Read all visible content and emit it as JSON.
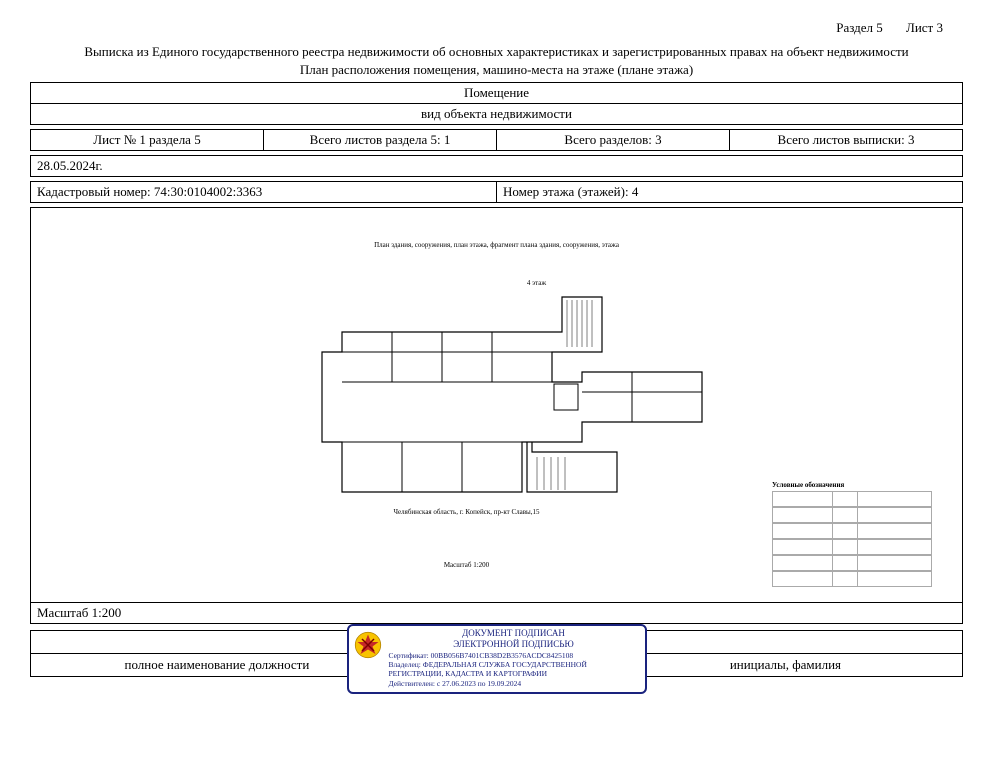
{
  "header": {
    "section": "Раздел 5",
    "sheet": "Лист 3",
    "title1": "Выписка из Единого государственного реестра недвижимости об основных характеристиках и зарегистрированных правах на объект недвижимости",
    "title2": "План расположения помещения, машино-места на этаже (плане этажа)"
  },
  "object": {
    "type": "Помещение",
    "subtype": "вид объекта недвижимости"
  },
  "meta": {
    "sheet_of_section": "Лист № 1 раздела 5",
    "total_sheets_section": "Всего листов раздела 5: 1",
    "total_sections": "Всего разделов: 3",
    "total_sheets_extract": "Всего листов выписки: 3",
    "date": "28.05.2024г.",
    "cadastral": "Кадастровый номер: 74:30:0104002:3363",
    "floor": "Номер этажа (этажей): 4"
  },
  "plan": {
    "caption": "План здания, сооружения, план этажа, фрагмент плана здания, сооружения, этажа",
    "floor_label": "4 этаж",
    "address": "Челябинская область, г. Копейск,  пр-кт Славы,15",
    "scale_inner": "Масштаб 1:200",
    "legend_title": "Условные обозначения"
  },
  "scale_row": "Масштаб 1:200",
  "footer": {
    "left": "полное наименование должности",
    "right": "инициалы, фамилия"
  },
  "stamp": {
    "l1": "ДОКУМЕНТ ПОДПИСАН",
    "l2": "ЭЛЕКТРОННОЙ ПОДПИСЬЮ",
    "cert": "Сертификат: 00BB056B7401CB38D2B3576ACDC8425108",
    "owner": "Владелец: ФЕДЕРАЛЬНАЯ СЛУЖБА ГОСУДАРСТВЕННОЙ РЕГИСТРАЦИИ, КАДАСТРА И КАРТОГРАФИИ",
    "valid": "Действителен: с 27.06.2023 по 19.09.2024"
  }
}
